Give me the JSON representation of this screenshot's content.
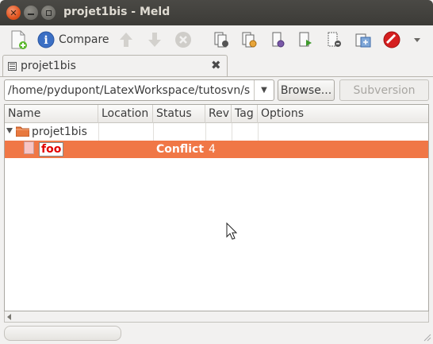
{
  "window": {
    "title": "projet1bis - Meld"
  },
  "toolbar": {
    "compare_label": "Compare",
    "icons": [
      "new-document-icon",
      "info-icon",
      "arrow-up-icon",
      "arrow-down-icon",
      "stop-icon",
      "vc-compare-icon",
      "vc-commit-icon",
      "vc-update-icon",
      "vc-add-icon",
      "vc-remove-icon",
      "vc-revert-icon",
      "vc-resolved-icon",
      "no-entry-icon",
      "overflow-chevron-icon"
    ]
  },
  "tab": {
    "label": "projet1bis",
    "close_glyph": "✖"
  },
  "location": {
    "path": "/home/pydupont/LatexWorkspace/tutosvn/s",
    "browse_label": "Browse...",
    "vcs_label": "Subversion"
  },
  "table": {
    "columns": [
      "Name",
      "Location",
      "Status",
      "Rev",
      "Tag",
      "Options"
    ],
    "rows": [
      {
        "name": "projet1bis",
        "location": "",
        "status": "",
        "rev": "",
        "tag": "",
        "options": ""
      },
      {
        "name": "foo",
        "location": "",
        "status": "Conflict",
        "rev": "4",
        "tag": "",
        "options": ""
      }
    ]
  },
  "colors": {
    "selection": "#f07746",
    "titlebar": "#3c3b37",
    "close_button": "#e0541f"
  }
}
